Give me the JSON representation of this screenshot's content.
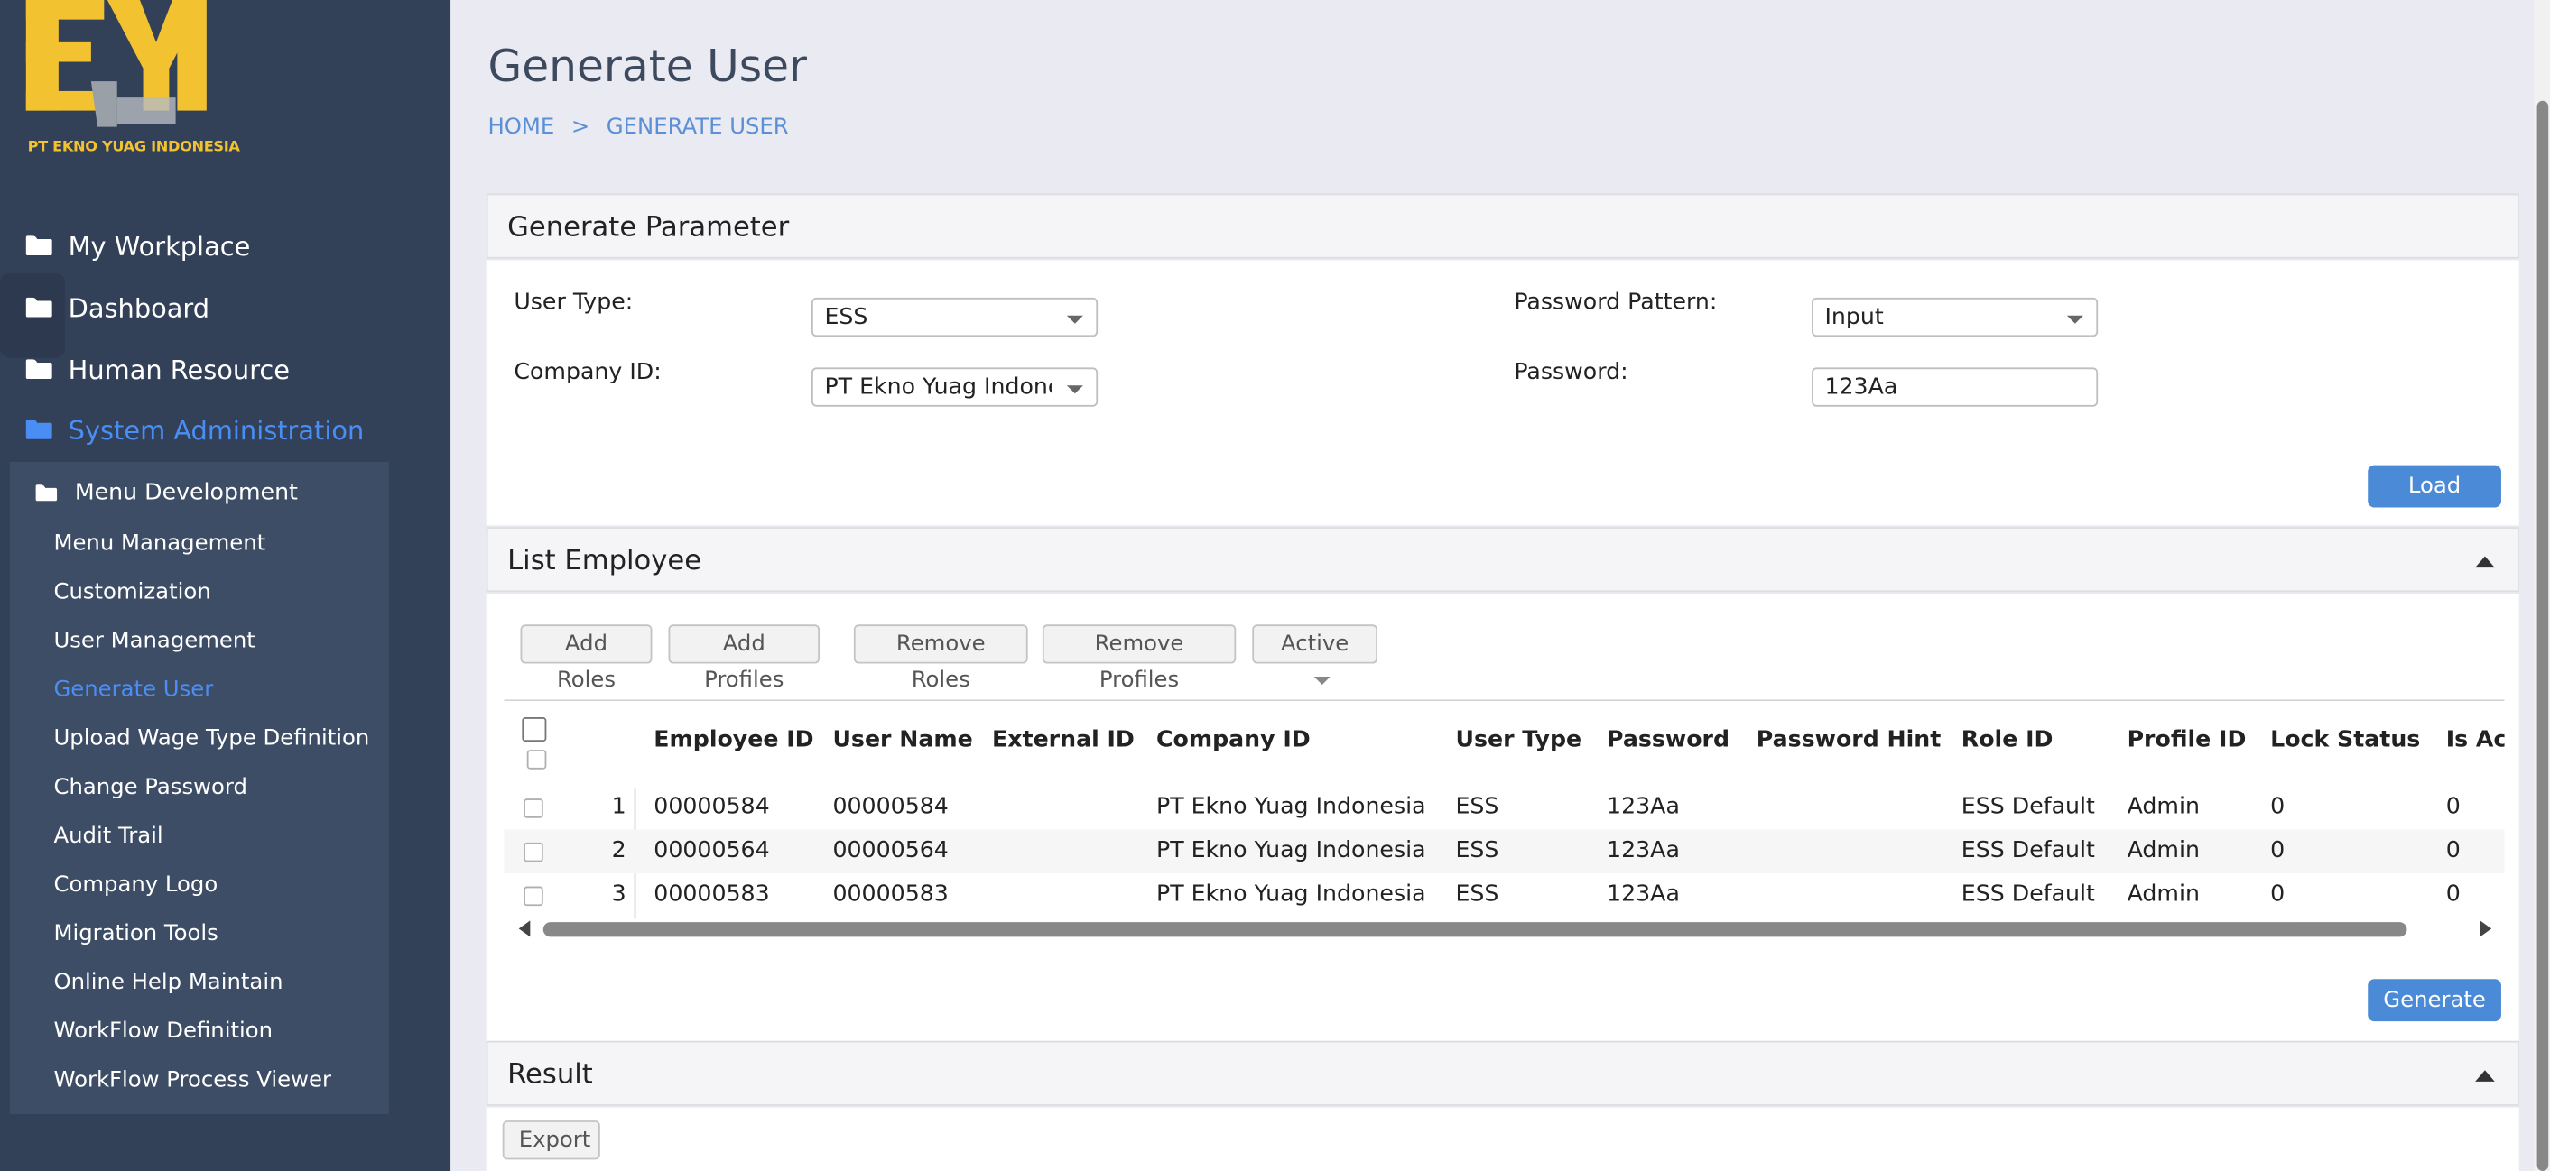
{
  "logo": {
    "company_name": "PT EKNO YUAG INDONESIA",
    "mark": "EYI",
    "color": "#f2c230"
  },
  "sidebar": {
    "items": [
      {
        "label": "My Workplace",
        "icon": "folder-icon"
      },
      {
        "label": "Dashboard",
        "icon": "folder-icon"
      },
      {
        "label": "Human Resource",
        "icon": "folder-icon"
      },
      {
        "label": "System Administration",
        "icon": "folder-icon",
        "active": true
      }
    ],
    "submenu": {
      "head": "Menu Development",
      "items": [
        "Menu Management",
        "Customization",
        "User Management",
        "Generate User",
        "Upload Wage Type Definition",
        "Change Password",
        "Audit Trail",
        "Company Logo",
        "Migration Tools",
        "Online Help Maintain",
        "WorkFlow Definition",
        "WorkFlow Process Viewer"
      ],
      "active_index": 3
    }
  },
  "page": {
    "title": "Generate User",
    "breadcrumb": [
      "HOME",
      ">",
      "GENERATE USER"
    ]
  },
  "generate_parameter": {
    "title": "Generate Parameter",
    "user_type_label": "User Type:",
    "user_type_value": "ESS",
    "company_id_label": "Company ID:",
    "company_id_value": "PT Ekno Yuag Indonesia",
    "password_pattern_label": "Password Pattern:",
    "password_pattern_value": "Input",
    "password_label": "Password:",
    "password_value": "123Aa",
    "load_label": "Load"
  },
  "list_employee": {
    "title": "List Employee",
    "toolbar": {
      "add_roles": "Add Roles",
      "add_profiles": "Add Profiles",
      "remove_roles": "Remove Roles",
      "remove_profiles": "Remove Profiles",
      "status_filter": "Active"
    },
    "columns": [
      "Employee ID",
      "User Name",
      "External ID",
      "Company ID",
      "User Type",
      "Password",
      "Password Hint",
      "Role ID",
      "Profile ID",
      "Lock Status",
      "Is Act"
    ],
    "rows": [
      {
        "num": "1",
        "employee_id": "00000584",
        "user_name": "00000584",
        "external_id": "",
        "company_id": "PT Ekno Yuag Indonesia",
        "user_type": "ESS",
        "password": "123Aa",
        "password_hint": "",
        "role_id": "ESS Default",
        "profile_id": "Admin",
        "lock_status": "0",
        "is_active": "0"
      },
      {
        "num": "2",
        "employee_id": "00000564",
        "user_name": "00000564",
        "external_id": "",
        "company_id": "PT Ekno Yuag Indonesia",
        "user_type": "ESS",
        "password": "123Aa",
        "password_hint": "",
        "role_id": "ESS Default",
        "profile_id": "Admin",
        "lock_status": "0",
        "is_active": "0"
      },
      {
        "num": "3",
        "employee_id": "00000583",
        "user_name": "00000583",
        "external_id": "",
        "company_id": "PT Ekno Yuag Indonesia",
        "user_type": "ESS",
        "password": "123Aa",
        "password_hint": "",
        "role_id": "ESS Default",
        "profile_id": "Admin",
        "lock_status": "0",
        "is_active": "0"
      }
    ],
    "generate_label": "Generate"
  },
  "result": {
    "title": "Result",
    "export_label": "Export"
  },
  "colors": {
    "sidebar_bg": "#334158",
    "accent": "#4a8ef5",
    "button_blue": "#4a8ad6",
    "page_bg": "#e9eaf2"
  }
}
